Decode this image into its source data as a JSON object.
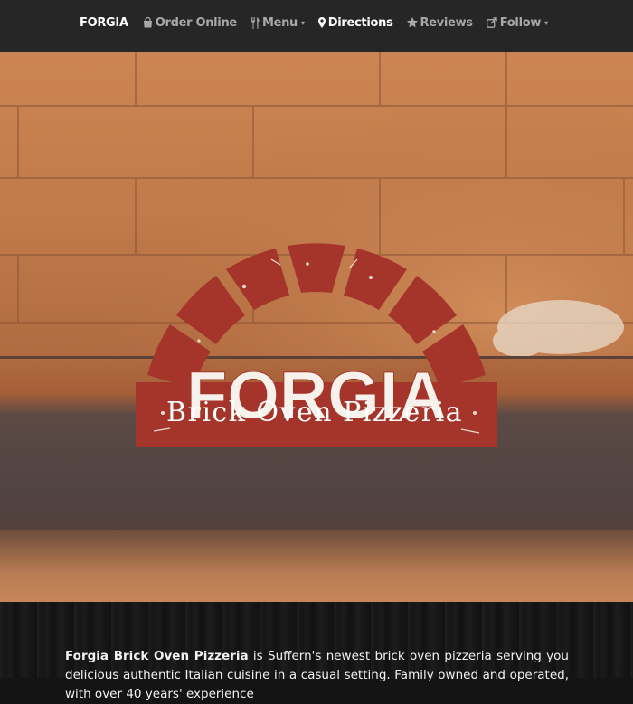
{
  "nav": {
    "brand": "FORGIA",
    "items": [
      {
        "label": "Order Online",
        "icon": "shopping-bag-icon"
      },
      {
        "label": "Menu",
        "icon": "utensils-icon",
        "dropdown": true
      },
      {
        "label": "Directions",
        "icon": "map-marker-icon",
        "active": true
      },
      {
        "label": "Reviews",
        "icon": "star-icon"
      },
      {
        "label": "Follow",
        "icon": "share-icon",
        "dropdown": true
      }
    ],
    "caret": "▾"
  },
  "hero": {
    "logo_word": "FORGIA",
    "logo_tagline": "Brick Oven Pizzeria"
  },
  "about": {
    "name": "Forgia Brick Oven Pizzeria",
    "text": " is Suffern's newest brick oven pizzeria serving you delicious authentic Italian cuisine in a casual setting. Family owned and operated, with over 40 years' experience"
  },
  "colors": {
    "nav_bg": "#262626",
    "brick_red": "#a5352a",
    "text_light": "#f2f2f2"
  }
}
